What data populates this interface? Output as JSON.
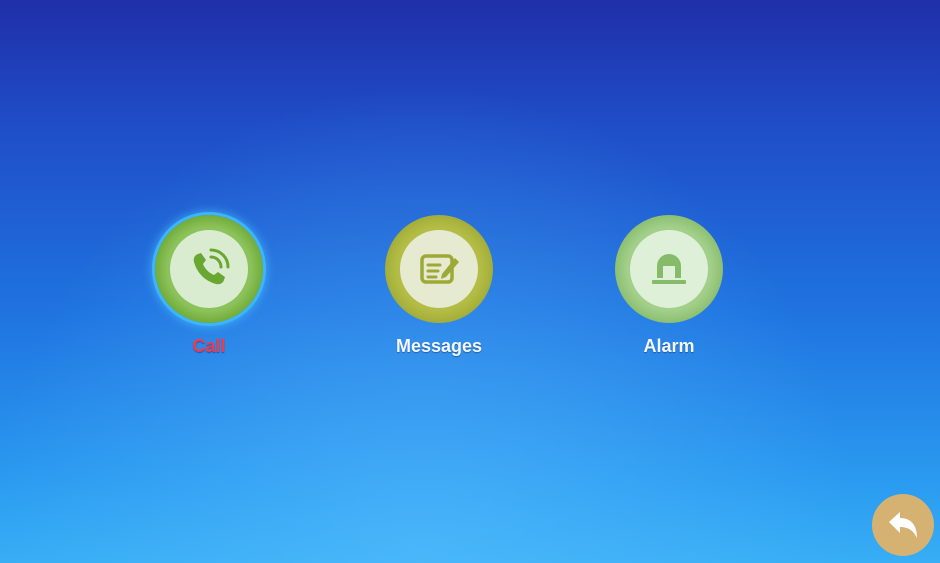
{
  "menu": {
    "items": [
      {
        "id": "call",
        "label": "Call",
        "icon": "phone-icon",
        "selected": true,
        "label_color": "#f23a4a"
      },
      {
        "id": "messages",
        "label": "Messages",
        "icon": "message-edit-icon",
        "selected": false,
        "label_color": "#f4f8ff"
      },
      {
        "id": "alarm",
        "label": "Alarm",
        "icon": "alarm-siren-icon",
        "selected": false,
        "label_color": "#f4f8ff"
      }
    ]
  },
  "back": {
    "icon": "back-arrow-icon"
  },
  "colors": {
    "background_top": "#1f2fa8",
    "background_bottom": "#37aef5",
    "icon_green": "#8cc25a",
    "back_button": "#d6b272"
  }
}
